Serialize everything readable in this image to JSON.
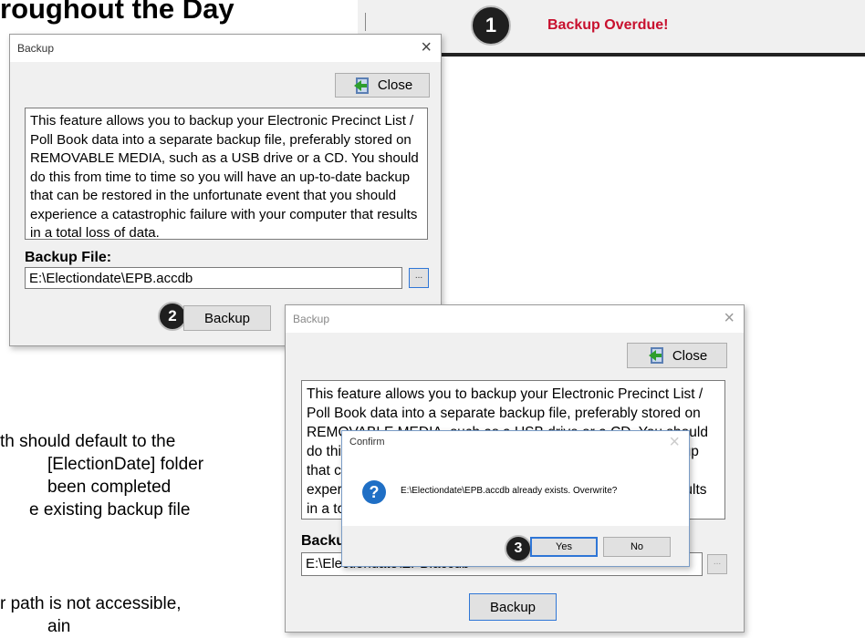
{
  "heading": "roughout the Day",
  "bottom_text": {
    "lines": [
      "th should default to the",
      "[ElectionDate] folder",
      "been completed",
      "e existing backup file",
      "r path is not accessible,",
      "ain"
    ]
  },
  "overdue_bar": {
    "step": "1",
    "label": "Backup Overdue!",
    "color": "#c8102e"
  },
  "backup_dialog_1": {
    "title": "Backup",
    "close_button": "Close",
    "description": "This feature allows you to backup your Electronic Precinct List /\nPoll Book data into a separate backup file, preferably stored on\nREMOVABLE MEDIA, such as a USB drive or a CD. You should\ndo this from time to time so you will have an up-to-date backup\nthat can be restored in the unfortunate event that you should\nexperience a catastrophic failure with your computer that results\nin a total loss of data.",
    "field_label": "Backup File:",
    "field_value": "E:\\Electiondate\\EPB.accdb",
    "browse": "...",
    "step": "2",
    "backup_button": "Backup"
  },
  "backup_dialog_2": {
    "title": "Backup",
    "close_button": "Close",
    "description": "This feature allows you to backup your Electronic Precinct List /\nPoll Book data into a separate backup file, preferably stored on\nREMOVABLE MEDIA, such as a USB drive or a CD. You should\ndo this from time to time so you will have an up-to-date backup\nthat can be restored in the unfortunate event that you should\nexperience a catastrophic failure with your computer that results\nin a total loss of data.",
    "field_label": "Backup File:",
    "field_value": "E:\\Electiondate\\EPB.accdb",
    "browse": "...",
    "backup_button": "Backup"
  },
  "confirm_dialog": {
    "title": "Confirm",
    "message": "E:\\Electiondate\\EPB.accdb already exists. Overwrite?",
    "step": "3",
    "yes_button": "Yes",
    "no_button": "No"
  }
}
